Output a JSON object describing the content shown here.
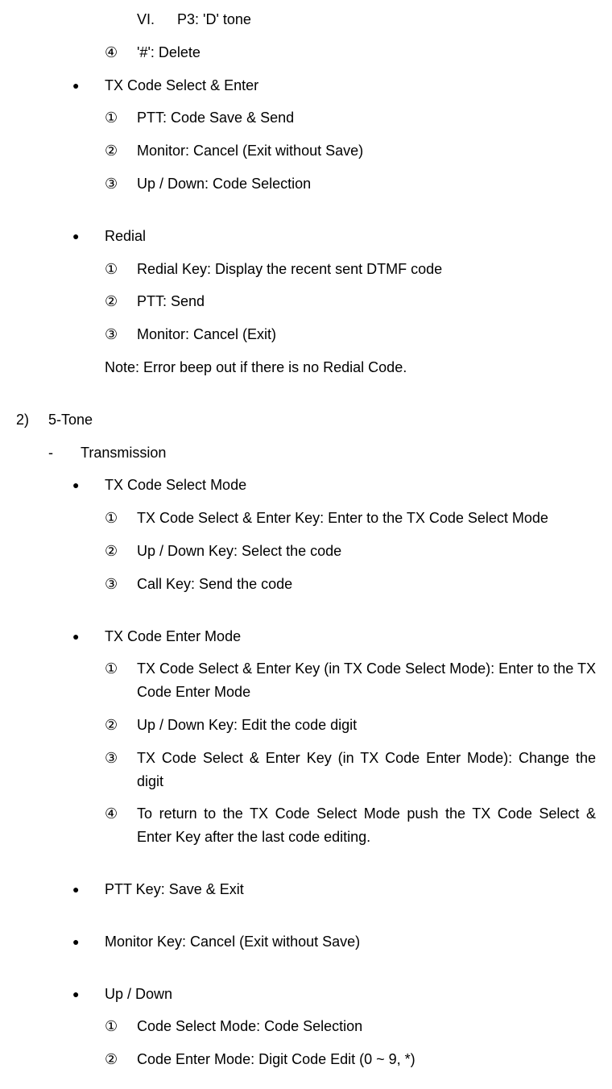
{
  "section1": {
    "item_vi": {
      "marker": "VI.",
      "text": "P3: 'D' tone"
    },
    "item_c4": {
      "marker": "④",
      "text": "'#': Delete"
    },
    "bullet_tx_select": "TX Code Select & Enter",
    "tx_select_items": {
      "c1": {
        "marker": "①",
        "text": "PTT: Code Save & Send"
      },
      "c2": {
        "marker": "②",
        "text": "Monitor: Cancel (Exit without Save)"
      },
      "c3": {
        "marker": "③",
        "text": "Up / Down: Code Selection"
      }
    },
    "bullet_redial": "Redial",
    "redial_items": {
      "c1": {
        "marker": "①",
        "text": "Redial Key: Display the recent sent DTMF code"
      },
      "c2": {
        "marker": "②",
        "text": "PTT: Send"
      },
      "c3": {
        "marker": "③",
        "text": "Monitor: Cancel (Exit)"
      }
    },
    "redial_note": "Note: Error beep out if there is no Redial Code."
  },
  "section2": {
    "heading": {
      "marker": "2)",
      "text": "5-Tone"
    },
    "transmission": {
      "marker": "-",
      "text": "Transmission"
    },
    "bullet_tx_select_mode": "TX Code Select Mode",
    "tx_select_mode_items": {
      "c1": {
        "marker": "①",
        "text": "TX Code Select & Enter Key: Enter to the TX Code Select Mode"
      },
      "c2": {
        "marker": "②",
        "text": "Up / Down Key: Select the code"
      },
      "c3": {
        "marker": "③",
        "text": "Call Key: Send the code"
      }
    },
    "bullet_tx_enter_mode": "TX Code Enter Mode",
    "tx_enter_mode_items": {
      "c1": {
        "marker": "①",
        "text": "TX Code Select & Enter Key (in TX Code Select Mode): Enter to the TX Code Enter Mode"
      },
      "c2": {
        "marker": "②",
        "text": "Up / Down Key: Edit the code digit"
      },
      "c3": {
        "marker": "③",
        "text": "TX Code Select & Enter Key (in TX Code Enter Mode): Change the digit"
      },
      "c4": {
        "marker": "④",
        "text": "To return to the TX Code Select Mode push the TX Code Select & Enter Key after the last code editing."
      }
    },
    "bullet_ptt": "PTT Key: Save & Exit",
    "bullet_monitor": "Monitor Key: Cancel (Exit without Save)",
    "bullet_updown": "Up / Down",
    "updown_items": {
      "c1": {
        "marker": "①",
        "text": "Code Select Mode: Code Selection"
      },
      "c2": {
        "marker": "②",
        "text": "Code Enter Mode: Digit Code Edit (0 ~ 9, *)"
      }
    }
  }
}
